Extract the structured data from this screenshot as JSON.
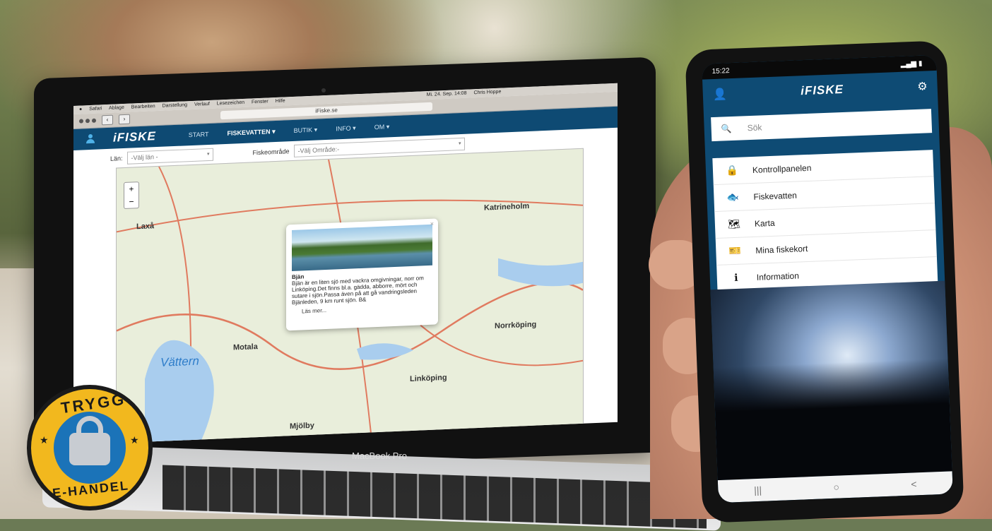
{
  "mac_menubar": [
    "Safari",
    "Ablage",
    "Bearbeiten",
    "Darstellung",
    "Verlauf",
    "Lesezeichen",
    "Fenster",
    "Hilfe",
    "Mi. 24. Sep. 14:08",
    "Chris Hoppe"
  ],
  "browser": {
    "url": "iFiske.se"
  },
  "site": {
    "logo": "iFISKE",
    "nav": [
      "START",
      "FISKEVATTEN ▾",
      "BUTIK ▾",
      "INFO ▾",
      "OM ▾"
    ],
    "filters": {
      "lan_label": "Län:",
      "lan_placeholder": "-Välj län -",
      "area_label": "Fiskeområde",
      "area_placeholder": "-Välj Område:-"
    }
  },
  "map": {
    "zoom": [
      "+",
      "−"
    ],
    "places": [
      "Laxå",
      "Katrineholm",
      "Motala",
      "Norrköping",
      "Linköping",
      "Mjölby"
    ],
    "lake": "Vättern",
    "popup": {
      "title": "Bjän",
      "text": "Bjän är en liten sjö med vackra omgivningar, norr om Linköping.Det finns bl.a. gädda, abborre, mört och sutare i sjön.Passa även på att gå vandringsleden Bjänleden, 9 km runt sjön. B&",
      "more": "Läs mer..."
    }
  },
  "laptop": {
    "brand": "MacBook Pro"
  },
  "phone": {
    "status_time": "15:22",
    "logo": "iFISKE",
    "search_placeholder": "Sök",
    "menu": [
      {
        "icon": "lock-icon",
        "label": "Kontrollpanelen"
      },
      {
        "icon": "fish-icon",
        "label": "Fiskevatten"
      },
      {
        "icon": "map-icon",
        "label": "Karta"
      },
      {
        "icon": "ticket-icon",
        "label": "Mina fiskekort"
      },
      {
        "icon": "info-icon",
        "label": "Information"
      }
    ],
    "nav": [
      "|||",
      "○",
      "<"
    ]
  },
  "badge": {
    "top": "TRYGG",
    "bottom": "E-HANDEL"
  }
}
